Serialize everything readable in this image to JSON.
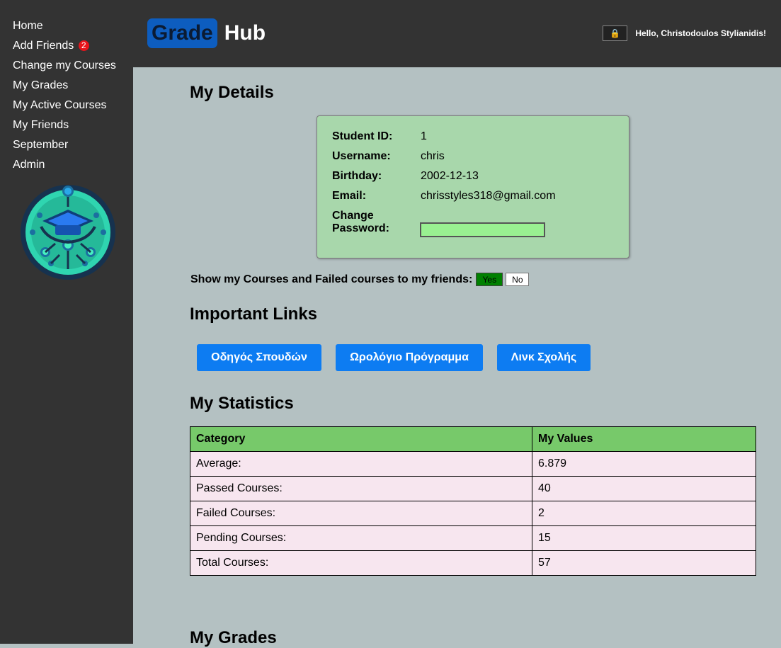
{
  "sidebar": {
    "items": [
      {
        "label": "Home"
      },
      {
        "label": "Add Friends",
        "badge": "2"
      },
      {
        "label": "Change my Courses"
      },
      {
        "label": "My Grades"
      },
      {
        "label": "My Active Courses"
      },
      {
        "label": "My Friends"
      },
      {
        "label": "September"
      },
      {
        "label": "Admin"
      }
    ]
  },
  "header": {
    "brand_part1": "Grade",
    "brand_part2": "Hub",
    "lock_icon": "🔒",
    "greeting": "Hello, Christodoulos Stylianidis!"
  },
  "details": {
    "heading": "My Details",
    "student_id_label": "Student ID:",
    "student_id": "1",
    "username_label": "Username:",
    "username": "chris",
    "birthday_label": "Birthday:",
    "birthday": "2002-12-13",
    "email_label": "Email:",
    "email": "chrisstyles318@gmail.com",
    "change_password_label_1": "Change",
    "change_password_label_2": "Password:",
    "password_value": ""
  },
  "sharing": {
    "label": "Show my Courses and Failed courses to my friends:",
    "yes": "Yes",
    "no": "No",
    "selected": "Yes"
  },
  "links": {
    "heading": "Important Links",
    "items": [
      {
        "label": "Οδηγός Σπουδών"
      },
      {
        "label": "Ωρολόγιο Πρόγραμμα"
      },
      {
        "label": "Λινκ Σχολής"
      }
    ]
  },
  "statistics": {
    "heading": "My Statistics",
    "columns": [
      "Category",
      "My Values"
    ],
    "rows": [
      {
        "category": "Average:",
        "value": "6.879"
      },
      {
        "category": "Passed Courses:",
        "value": "40"
      },
      {
        "category": "Failed Courses:",
        "value": "2"
      },
      {
        "category": "Pending Courses:",
        "value": "15"
      },
      {
        "category": "Total Courses:",
        "value": "57"
      }
    ]
  },
  "grades": {
    "heading": "My Grades"
  },
  "colors": {
    "sidebar_bg": "#333333",
    "main_bg": "#b4c1c2",
    "card_bg": "#a8d7ab",
    "link_button": "#0d7cf2",
    "table_header": "#77c96a",
    "table_row": "#f7e6ef",
    "yes_active": "#008000"
  }
}
